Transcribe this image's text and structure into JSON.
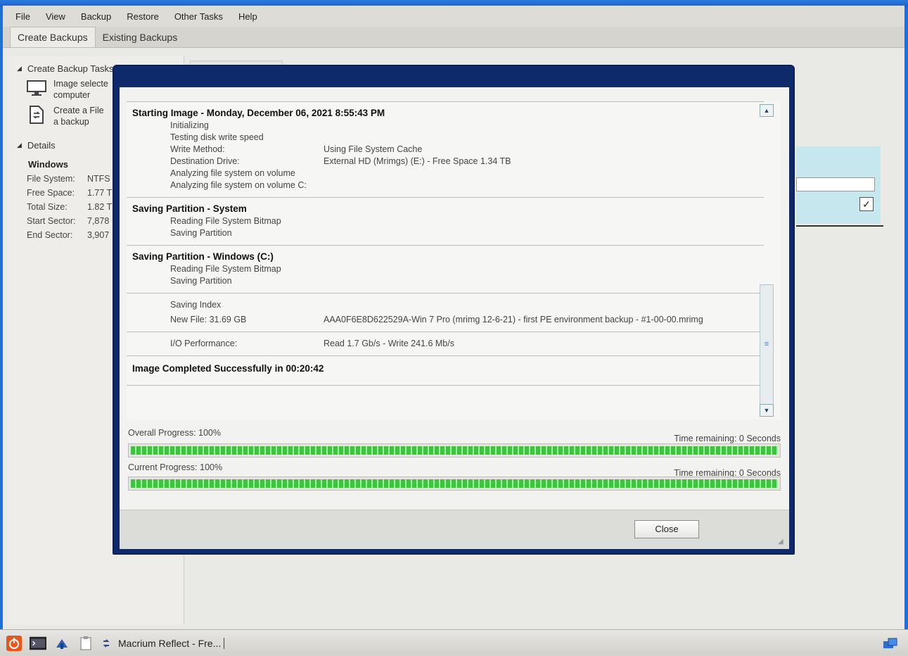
{
  "menu": [
    "File",
    "View",
    "Backup",
    "Restore",
    "Other Tasks",
    "Help"
  ],
  "tabs": [
    "Create Backups",
    "Existing Backups"
  ],
  "left": {
    "tasks_header": "Create Backup Tasks",
    "tasks": [
      {
        "label": "Image selecte computer",
        "icon": "monitor-icon"
      },
      {
        "label": "Create a File a backup",
        "icon": "file-backup-icon"
      }
    ],
    "details_header": "Details",
    "details_title": "Windows",
    "details": [
      {
        "label": "File System:",
        "value": "NTFS"
      },
      {
        "label": "Free Space:",
        "value": "1.77 T"
      },
      {
        "label": "Total Size:",
        "value": "1.82 TE"
      },
      {
        "label": "Start Sector:",
        "value": "7,878"
      },
      {
        "label": "End Sector:",
        "value": "3,907"
      }
    ]
  },
  "log": {
    "starting": {
      "title": "Starting Image - Monday, December 06, 2021 8:55:43 PM",
      "lines": [
        {
          "k": "Initializing",
          "v": ""
        },
        {
          "k": "Testing disk write speed",
          "v": ""
        },
        {
          "k": "Write Method:",
          "v": "Using File System Cache"
        },
        {
          "k": "Destination Drive:",
          "v": "External HD (Mrimgs) (E:) - Free Space 1.34 TB"
        },
        {
          "k": "Analyzing file system on volume",
          "v": ""
        },
        {
          "k": "Analyzing file system on volume C:",
          "v": ""
        }
      ]
    },
    "system": {
      "title": "Saving Partition - System",
      "lines": [
        "Reading File System Bitmap",
        "Saving Partition"
      ]
    },
    "windows": {
      "title": "Saving Partition - Windows (C:)",
      "lines": [
        "Reading File System Bitmap",
        "Saving Partition"
      ]
    },
    "index": {
      "l1": "Saving Index",
      "l2k": "New File: 31.69 GB",
      "l2v": "AAA0F6E8D622529A-Win 7 Pro (mrimg 12-6-21) - first PE environment backup - #1-00-00.mrimg"
    },
    "io": {
      "k": "I/O Performance:",
      "v": "Read 1.7 Gb/s - Write 241.6 Mb/s"
    },
    "completed": "Image Completed Successfully in 00:20:42"
  },
  "progress": {
    "overall_label": "Overall Progress:  100%",
    "overall_time": "Time remaining: 0 Seconds",
    "overall_value": 1.0,
    "current_label": "Current Progress:  100%",
    "current_time": "Time remaining: 0 Seconds",
    "current_value": 1.0
  },
  "close_label": "Close",
  "taskbar_task": "Macrium Reflect - Fre..."
}
